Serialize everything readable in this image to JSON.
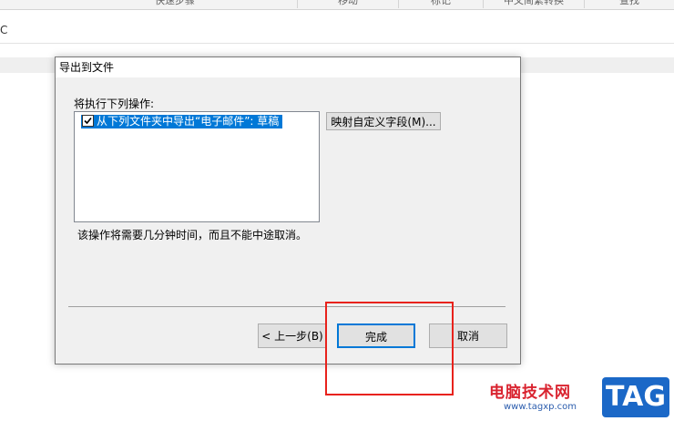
{
  "background": {
    "ribbon_groups": [
      "快速步骤",
      "移动",
      "标记",
      "中文简繁转换",
      "查找"
    ],
    "left_glyph": "C"
  },
  "dialog": {
    "title": "导出到文件",
    "operations_label": "将执行下列操作:",
    "operations": [
      {
        "label": "从下列文件夹中导出“电子邮件”: 草稿",
        "checked": true
      }
    ],
    "map_fields_button": "映射自定义字段(M)...",
    "note": "该操作将需要几分钟时间，而且不能中途取消。",
    "buttons": {
      "back": "< 上一步(B)",
      "finish": "完成",
      "cancel": "取消"
    }
  },
  "watermark": {
    "text": "电脑技术网",
    "url": "www.tagxp.com",
    "badge": "TAG"
  },
  "colors": {
    "selection": "#0078d7",
    "annotation": "#e8221c",
    "watermark_red": "#d9232f",
    "watermark_blue": "#1b68c7"
  }
}
